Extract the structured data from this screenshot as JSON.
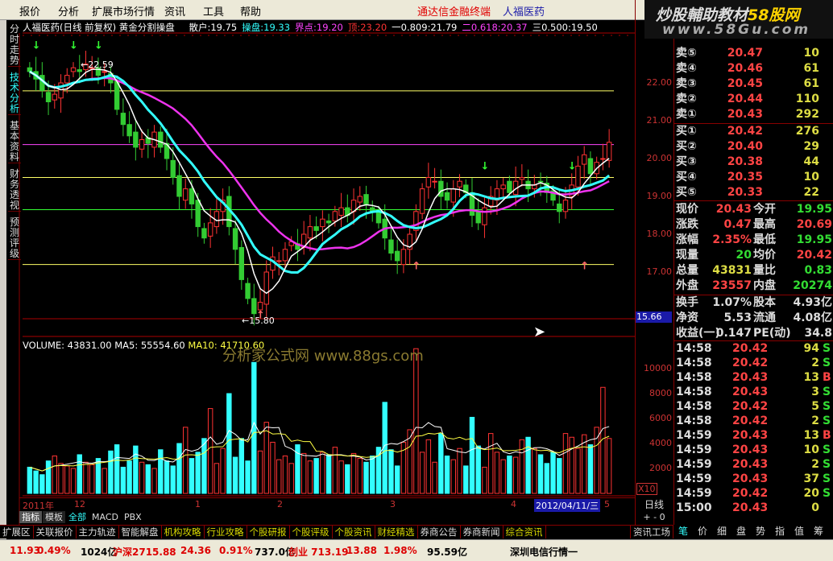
{
  "menu": {
    "items": [
      "报价",
      "分析",
      "扩展市场行情",
      "资讯",
      "工具",
      "帮助"
    ],
    "brand": "通达信金融终端",
    "stock": "人福医药"
  },
  "logo": {
    "line1a": "炒股輔助教材",
    "line1b": "58股网",
    "line2": "www.58Gu.com"
  },
  "sidetabs": [
    "分时走势",
    "技术分析",
    "基本资料",
    "财务透视",
    "预测评级"
  ],
  "info": {
    "title": "人福医药(日线 前复权) 黄金分割操盘",
    "items": [
      {
        "t": "散户:19.75",
        "c": "#ffffff"
      },
      {
        "t": "操盘:19.33",
        "c": "#33ffff"
      },
      {
        "t": "界点:19.20",
        "c": "#ff44ff"
      },
      {
        "t": "顶:23.20",
        "c": "#ff3333"
      },
      {
        "t": "一0.809:21.79",
        "c": "#ffffff"
      },
      {
        "t": "二0.618:20.37",
        "c": "#ff44ff"
      },
      {
        "t": "三0.500:19.50",
        "c": "#ffffff"
      }
    ]
  },
  "annot": {
    "high": "←22.59",
    "low": "←15.80"
  },
  "price_axis": [
    "22.00",
    "21.00",
    "20.00",
    "19.00",
    "18.00",
    "17.00"
  ],
  "cursor_price": "15.66",
  "volume": {
    "legend_vol": "VOLUME: 43831.00",
    "legend_ma5": "MA5: 55554.60",
    "legend_ma10": "MA10: 41710.60",
    "axis": [
      "10000",
      "8000",
      "6000",
      "4000",
      "2000"
    ],
    "unit": "X10"
  },
  "watermark": "分析家公式网 www.88gs.com",
  "chart_data": {
    "type": "candlestick",
    "price_range": [
      15.5,
      23.0
    ],
    "volume_range": [
      0,
      12000
    ],
    "closes": [
      22.3,
      22.1,
      21.8,
      21.5,
      21.7,
      22.0,
      22.2,
      22.4,
      22.3,
      22.5,
      22.4,
      22.2,
      22.3,
      22.0,
      21.3,
      20.9,
      20.6,
      20.3,
      20.5,
      20.4,
      20.7,
      20.3,
      20.0,
      19.5,
      19.0,
      19.2,
      18.8,
      18.2,
      17.9,
      18.3,
      18.6,
      18.9,
      18.2,
      17.6,
      16.8,
      16.3,
      15.9,
      16.2,
      17.0,
      17.4,
      17.3,
      17.6,
      17.8,
      17.6,
      18.0,
      18.2,
      18.1,
      18.4,
      18.3,
      18.6,
      18.7,
      18.5,
      18.9,
      19.0,
      18.8,
      18.6,
      18.3,
      17.9,
      17.5,
      17.3,
      17.6,
      18.0,
      18.6,
      19.2,
      19.5,
      19.4,
      19.0,
      18.9,
      19.2,
      19.4,
      19.1,
      18.5,
      18.3,
      18.7,
      19.0,
      19.2,
      19.3,
      19.1,
      19.4,
      19.5,
      19.2,
      19.3,
      19.4,
      19.1,
      18.9,
      18.6,
      18.9,
      19.3,
      19.8,
      20.1,
      19.6,
      19.9,
      20.0,
      20.43
    ],
    "volumes": [
      2100,
      1800,
      1500,
      2600,
      3000,
      2400,
      2200,
      2000,
      3100,
      2500,
      2300,
      2800,
      2000,
      3400,
      3900,
      2100,
      2600,
      3800,
      2500,
      2300,
      2000,
      3500,
      2600,
      2200,
      4000,
      5300,
      2800,
      3300,
      4400,
      6800,
      2400,
      3600,
      8000,
      2900,
      4400,
      2600,
      10500,
      3400,
      5700,
      4100,
      2700,
      3000,
      2400,
      3900,
      3200,
      2600,
      2800,
      3300,
      3100,
      3700,
      2600,
      2300,
      3200,
      2800,
      2500,
      3000,
      3700,
      7300,
      3500,
      2200,
      4100,
      5100,
      11600,
      3300,
      4300,
      2500,
      4800,
      3000,
      2700,
      3600,
      2200,
      6100,
      3800,
      2100,
      4800,
      3300,
      2700,
      3000,
      2900,
      4300,
      4500,
      3600,
      3100,
      2400,
      3300,
      2800,
      4800,
      4500,
      3600,
      4700,
      3900,
      5300,
      8500,
      4400
    ],
    "horizontal_lines": [
      {
        "price": 21.79,
        "color": "#ffff66"
      },
      {
        "price": 20.37,
        "color": "#ff44ff"
      },
      {
        "price": 19.5,
        "color": "#ffff66"
      },
      {
        "price": 18.65,
        "color": "#33ff33"
      },
      {
        "price": 17.2,
        "color": "#ffff66"
      }
    ]
  },
  "datebar": {
    "year": "2011年",
    "marks": [
      "12",
      "1",
      "2",
      "3",
      "4"
    ],
    "selected": "2012/04/11/三",
    "last": "5",
    "period": "日线",
    "pm": "+ - 0"
  },
  "indtabs": [
    "指标",
    "模板",
    "全部",
    "MACD",
    "PBX"
  ],
  "bottom_tabs": [
    {
      "t": "扩展区",
      "c": "#ddd"
    },
    {
      "t": "关联报价",
      "c": "#ddd"
    },
    {
      "t": "主力轨迹",
      "c": "#ddd"
    },
    {
      "t": "智能解盘",
      "c": "#ddd"
    },
    {
      "t": "机构攻略",
      "c": "#d8d800"
    },
    {
      "t": "行业攻略",
      "c": "#d8d800"
    },
    {
      "t": "个股研报",
      "c": "#d8d800"
    },
    {
      "t": "个股评级",
      "c": "#d8d800"
    },
    {
      "t": "个股资讯",
      "c": "#d8d800"
    },
    {
      "t": "财经精选",
      "c": "#d8d800"
    },
    {
      "t": "券商公告",
      "c": "#ddd"
    },
    {
      "t": "券商新闻",
      "c": "#ddd"
    },
    {
      "t": "综合资讯",
      "c": "#d8d800"
    },
    {
      "t": "资讯工场",
      "c": "#ddd"
    }
  ],
  "right_tabs": [
    "笔",
    "价",
    "细",
    "盘",
    "势",
    "指",
    "值",
    "筹"
  ],
  "orderbook": {
    "sell": [
      [
        "卖⑤",
        "20.47",
        "10"
      ],
      [
        "卖④",
        "20.46",
        "61"
      ],
      [
        "卖③",
        "20.45",
        "61"
      ],
      [
        "卖②",
        "20.44",
        "110"
      ],
      [
        "卖①",
        "20.43",
        "292"
      ]
    ],
    "buy": [
      [
        "买①",
        "20.42",
        "276"
      ],
      [
        "买②",
        "20.40",
        "29"
      ],
      [
        "买③",
        "20.38",
        "44"
      ],
      [
        "买④",
        "20.35",
        "10"
      ],
      [
        "买⑤",
        "20.33",
        "22"
      ]
    ]
  },
  "quote": [
    [
      "现价",
      "20.43",
      "#ff4444",
      "今开",
      "19.95",
      "#33dd33"
    ],
    [
      "涨跌",
      "0.47",
      "#ff4444",
      "最高",
      "20.69",
      "#ff4444"
    ],
    [
      "涨幅",
      "2.35%",
      "#ff4444",
      "最低",
      "19.95",
      "#33dd33"
    ],
    [
      "现量",
      "20",
      "#33dd33",
      "均价",
      "20.42",
      "#ff4444"
    ],
    [
      "总量",
      "43831",
      "#dddd44",
      "量比",
      "0.83",
      "#33dd33"
    ],
    [
      "外盘",
      "23557",
      "#ff4444",
      "内盘",
      "20274",
      "#33dd33"
    ]
  ],
  "fund": [
    [
      "换手",
      "1.07%",
      "股本",
      "4.93亿"
    ],
    [
      "净资",
      "5.53",
      "流通",
      "4.08亿"
    ],
    [
      "收益(一)",
      "0.147",
      "PE(动)",
      "34.8"
    ]
  ],
  "ticks": [
    [
      "14:58",
      "20.42",
      "94",
      "S"
    ],
    [
      "14:58",
      "20.42",
      "2",
      "S"
    ],
    [
      "14:58",
      "20.43",
      "13",
      "B"
    ],
    [
      "14:58",
      "20.43",
      "3",
      "S"
    ],
    [
      "14:58",
      "20.42",
      "5",
      "S"
    ],
    [
      "14:58",
      "20.42",
      "2",
      "S"
    ],
    [
      "14:59",
      "20.43",
      "13",
      "B"
    ],
    [
      "14:59",
      "20.43",
      "10",
      "S"
    ],
    [
      "14:59",
      "20.43",
      "2",
      "S"
    ],
    [
      "14:59",
      "20.43",
      "37",
      "S"
    ],
    [
      "14:59",
      "20.42",
      "20",
      "S"
    ],
    [
      "15:00",
      "20.43",
      "0",
      ""
    ]
  ],
  "status": [
    {
      "t": "11.93",
      "c": "#d00"
    },
    {
      "t": "0.49%",
      "c": "#d00"
    },
    {
      "t": "1024亿",
      "c": "#000"
    },
    {
      "t": "沪深2715.88",
      "c": "#d00"
    },
    {
      "t": "24.36",
      "c": "#d00"
    },
    {
      "t": "0.91%",
      "c": "#d00"
    },
    {
      "t": "737.0亿",
      "c": "#000"
    },
    {
      "t": "创业 713.19",
      "c": "#d00"
    },
    {
      "t": "13.88",
      "c": "#d00"
    },
    {
      "t": "1.98%",
      "c": "#d00"
    },
    {
      "t": "95.59亿",
      "c": "#000"
    },
    {
      "t": "深圳电信行情一",
      "c": "#000"
    }
  ]
}
